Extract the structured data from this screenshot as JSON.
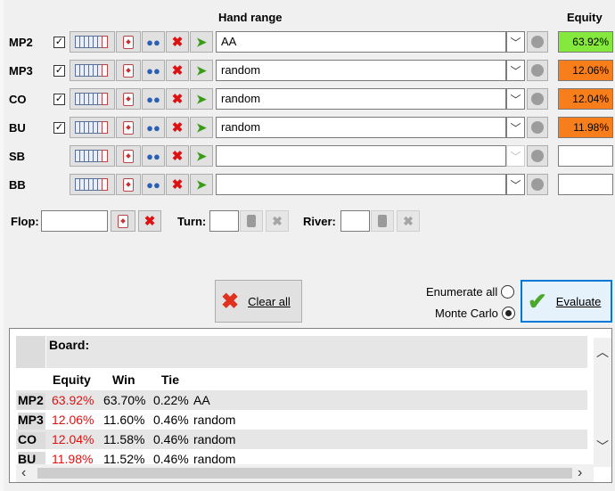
{
  "headers": {
    "hand_range": "Hand range",
    "equity": "Equity"
  },
  "players": [
    {
      "pos": "MP2",
      "checked": true,
      "range": "AA",
      "equity": "63.92%",
      "color": "#84e93c"
    },
    {
      "pos": "MP3",
      "checked": true,
      "range": "random",
      "equity": "12.06%",
      "color": "#f77e1a"
    },
    {
      "pos": "CO",
      "checked": true,
      "range": "random",
      "equity": "12.04%",
      "color": "#f77e1a"
    },
    {
      "pos": "BU",
      "checked": true,
      "range": "random",
      "equity": "11.98%",
      "color": "#f77e1a"
    },
    {
      "pos": "SB",
      "checked": false,
      "range": "",
      "equity": "",
      "color": "#ffffff"
    },
    {
      "pos": "BB",
      "checked": false,
      "range": "",
      "equity": "",
      "color": "#ffffff"
    }
  ],
  "board": {
    "flop_label": "Flop:",
    "turn_label": "Turn:",
    "river_label": "River:"
  },
  "actions": {
    "clear_all": "Clear all",
    "enumerate_all": "Enumerate all",
    "monte_carlo": "Monte Carlo",
    "evaluate": "Evaluate"
  },
  "results": {
    "board_label": "Board:",
    "columns": [
      "Equity",
      "Win",
      "Tie"
    ],
    "rows": [
      {
        "pos": "MP2",
        "equity": "63.92%",
        "win": "63.70%",
        "tie": "0.22%",
        "hand": "AA"
      },
      {
        "pos": "MP3",
        "equity": "12.06%",
        "win": "11.60%",
        "tie": "0.46%",
        "hand": "random"
      },
      {
        "pos": "CO",
        "equity": "12.04%",
        "win": "11.58%",
        "tie": "0.46%",
        "hand": "random"
      },
      {
        "pos": "BU",
        "equity": "11.98%",
        "win": "11.52%",
        "tie": "0.46%",
        "hand": "random"
      }
    ]
  },
  "colors": {
    "equity_text": "#e01010",
    "row_stripe": "#e6e6e6",
    "evaluate_border": "#0078d7"
  }
}
